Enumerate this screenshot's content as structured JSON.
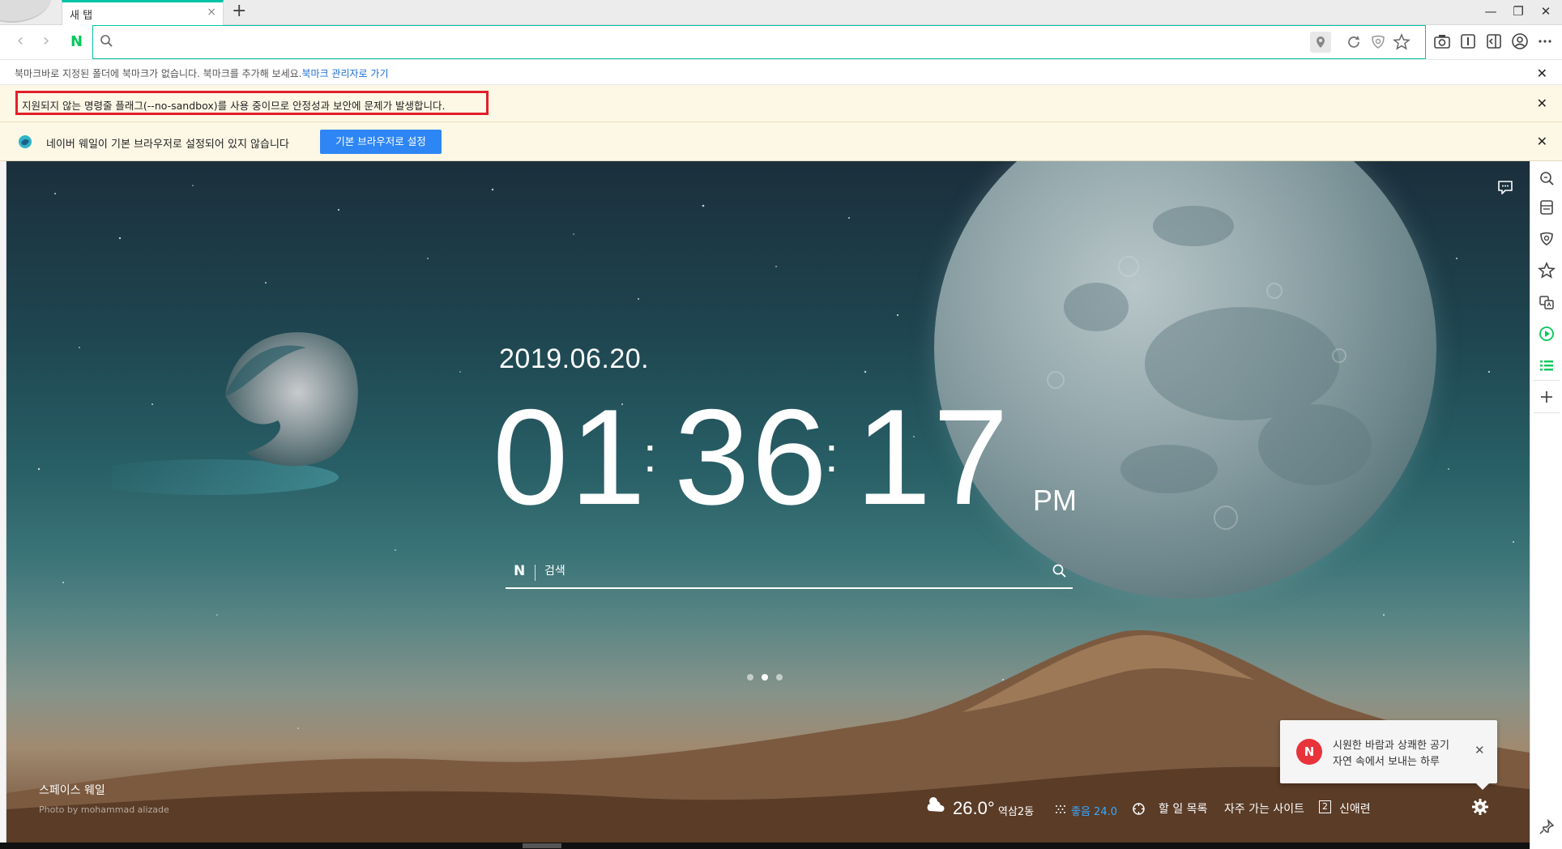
{
  "tab": {
    "title": "새 탭",
    "close": "×",
    "new_tab": "+"
  },
  "window": {
    "minimize": "—",
    "restore": "❐",
    "close": "✕"
  },
  "omnibox": {
    "value": "",
    "placeholder": ""
  },
  "bookmark_bar": {
    "message": "북마크바로 지정된 폴더에 북마크가 없습니다. 북마크를 추가해 보세요.",
    "link": "북마크 관리자로 가기",
    "close": "✕"
  },
  "warning_bar": {
    "message": "지원되지 않는 명령줄 플래그(--no-sandbox)를 사용 중이므로 안정성과 보안에 문제가 발생합니다.",
    "close": "✕"
  },
  "default_browser_bar": {
    "message": "네이버 웨일이 기본 브라우저로 설정되어 있지 않습니다",
    "button": "기본 브라우저로 설정",
    "close": "✕"
  },
  "ntp": {
    "date": "2019.06.20.",
    "clock": {
      "hours": "01",
      "minutes": "36",
      "seconds": "17",
      "ampm": "PM"
    },
    "search": {
      "logo": "N",
      "placeholder": "검색"
    },
    "page_dots": 3,
    "active_dot": 1,
    "credit": {
      "name": "스페이스 웨일",
      "photo": "Photo by mohammad alizade"
    },
    "weather": {
      "temp": "26.0°",
      "location": "역삼2동",
      "air_quality": "좋음 24.0"
    },
    "links": {
      "todo": "할 일 목록",
      "frequent": "자주 가는 사이트",
      "news_count": "2",
      "news": "신애련"
    },
    "toast": {
      "badge": "N",
      "line1": "시원한 바람과 상쾌한 공기",
      "line2": "자연 속에서 보내는 하루",
      "close": "✕"
    }
  },
  "colors": {
    "accent": "#00c3a6",
    "naver_green": "#03c75a",
    "warning_red": "#e0202a",
    "button_blue": "#2e86f5"
  }
}
